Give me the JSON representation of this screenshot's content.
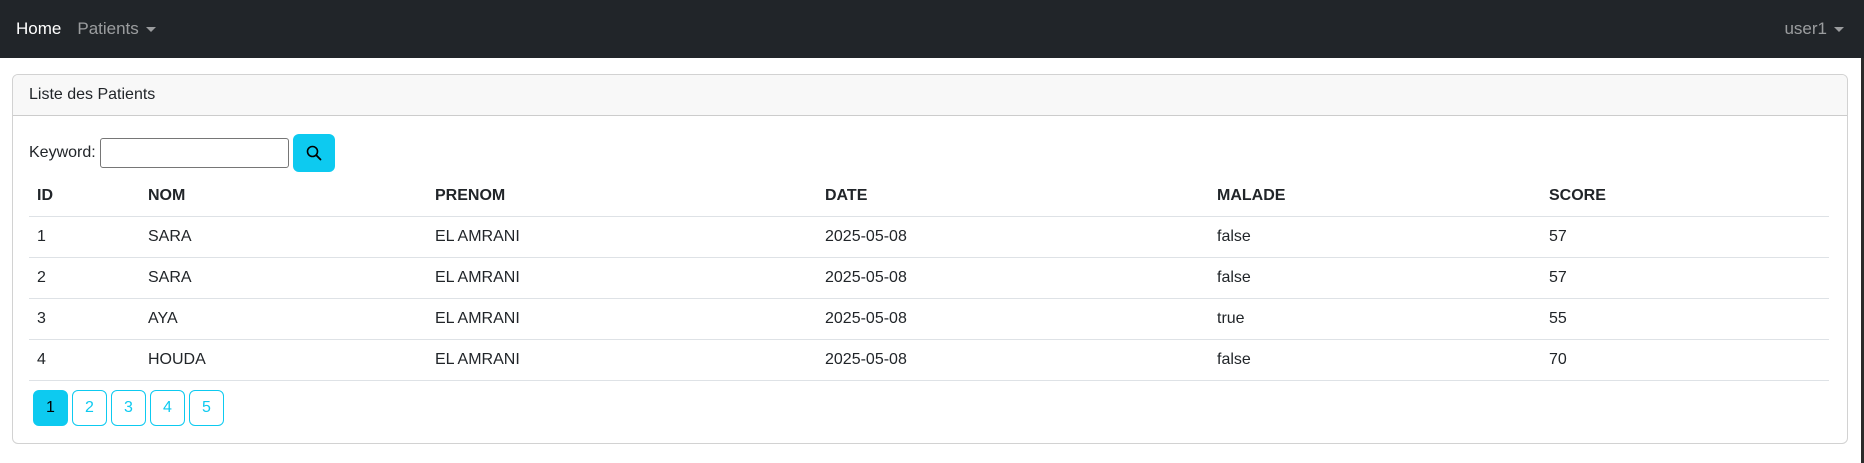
{
  "navbar": {
    "home": "Home",
    "patients": "Patients",
    "user": "user1"
  },
  "card": {
    "title": "Liste des Patients"
  },
  "search": {
    "label": "Keyword:",
    "value": "",
    "placeholder": "",
    "button_icon": "search-icon"
  },
  "table": {
    "columns": [
      "ID",
      "NOM",
      "PRENOM",
      "DATE",
      "MALADE",
      "SCORE"
    ],
    "rows": [
      [
        "1",
        "SARA",
        "EL AMRANI",
        "2025-05-08",
        "false",
        "57"
      ],
      [
        "2",
        "SARA",
        "EL AMRANI",
        "2025-05-08",
        "false",
        "57"
      ],
      [
        "3",
        "AYA",
        "EL AMRANI",
        "2025-05-08",
        "true",
        "55"
      ],
      [
        "4",
        "HOUDA",
        "EL AMRANI",
        "2025-05-08",
        "false",
        "70"
      ]
    ]
  },
  "pagination": {
    "pages": [
      "1",
      "2",
      "3",
      "4",
      "5"
    ],
    "current": "1"
  },
  "colors": {
    "navbar_bg": "#212529",
    "accent": "#0dcaf0"
  }
}
